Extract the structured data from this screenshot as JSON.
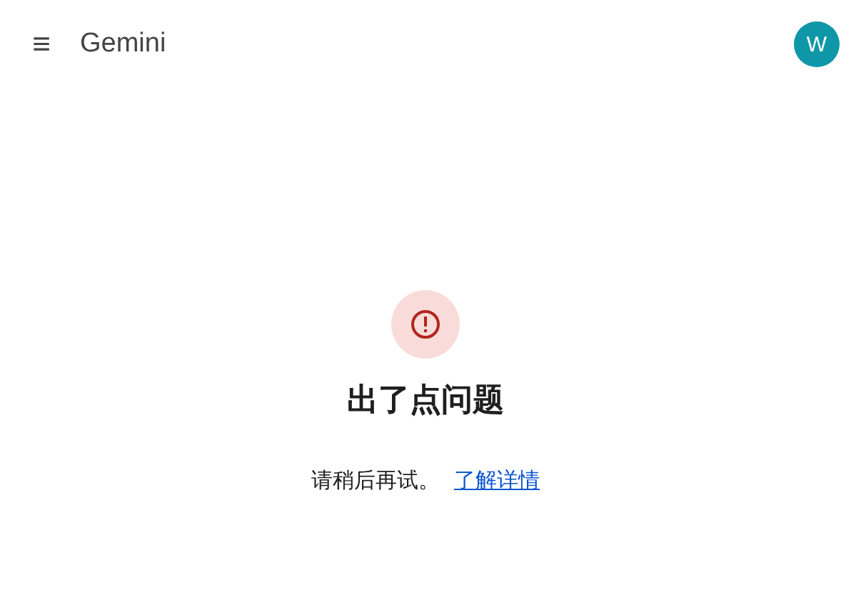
{
  "header": {
    "menu": "≡",
    "title": "Gemini",
    "avatar": "W"
  },
  "error": {
    "title": "出了点问题",
    "message": "请稍后再试。",
    "link": "了解详情"
  }
}
